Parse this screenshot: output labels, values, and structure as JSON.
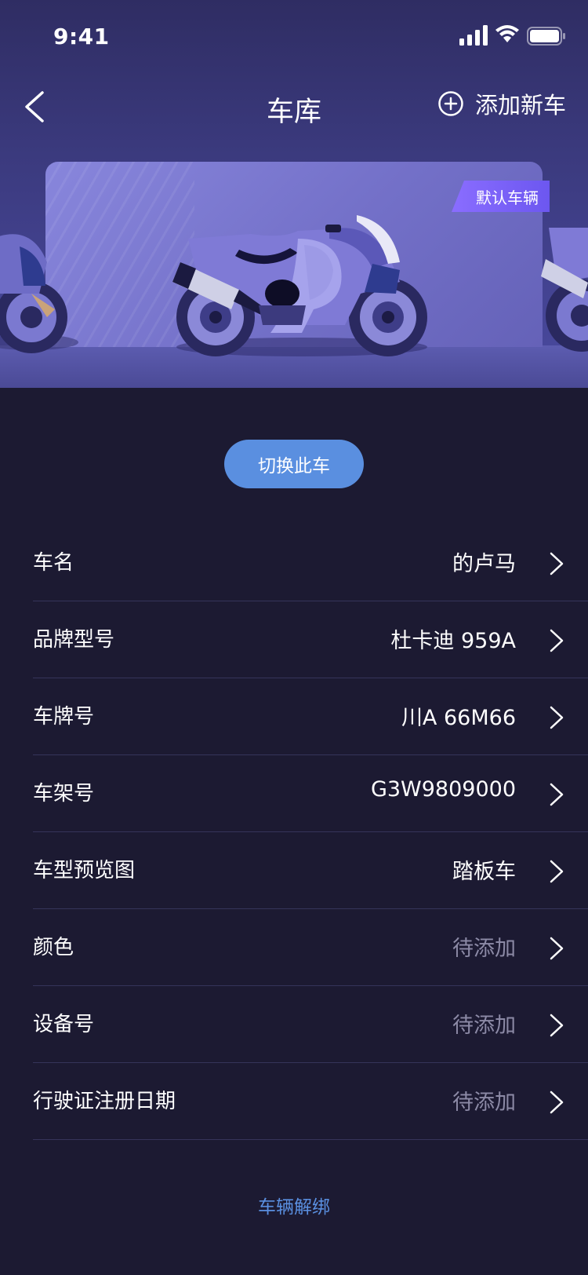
{
  "status_bar": {
    "time": "9:41"
  },
  "nav": {
    "title": "车库",
    "add_label": "添加新车"
  },
  "hero": {
    "default_badge": "默认车辆"
  },
  "switch_label": "切换此车",
  "rows": [
    {
      "label": "车名",
      "value": "的卢马",
      "pending": false
    },
    {
      "label": "品牌型号",
      "value": "杜卡迪 959A",
      "pending": false
    },
    {
      "label": "车牌号",
      "value": "川A 66M66",
      "pending": false
    },
    {
      "label": "车架号",
      "value": "G3W9809000",
      "pending": false
    },
    {
      "label": "车型预览图",
      "value": "踏板车",
      "pending": false
    },
    {
      "label": "颜色",
      "value": "待添加",
      "pending": true
    },
    {
      "label": "设备号",
      "value": "待添加",
      "pending": true
    },
    {
      "label": "行驶证注册日期",
      "value": "待添加",
      "pending": true
    }
  ],
  "unbind_label": "车辆解绑",
  "colors": {
    "accent": "#5a8fe0",
    "background": "#1c1a32",
    "badge": "#7a62f5"
  }
}
